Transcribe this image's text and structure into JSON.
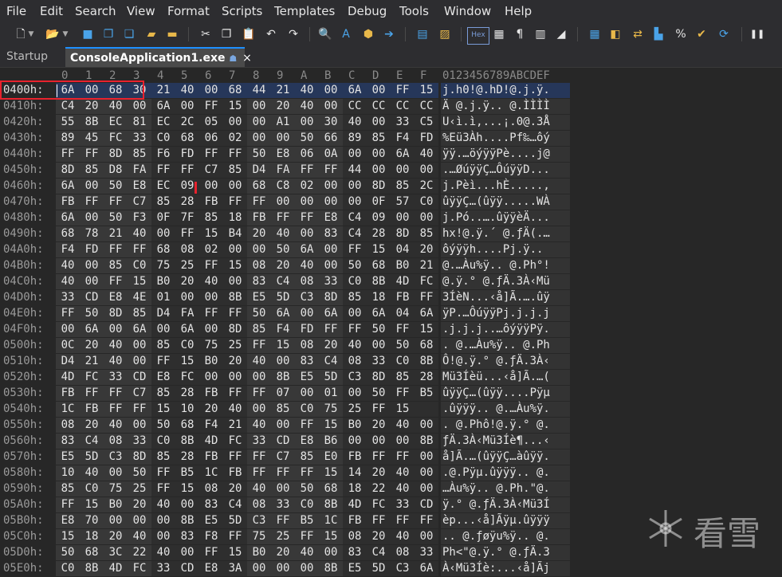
{
  "menu": [
    "File",
    "Edit",
    "Search",
    "View",
    "Format",
    "Scripts",
    "Templates",
    "Debug",
    "Tools",
    "Window",
    "Help"
  ],
  "toolbar": {
    "icons": [
      "new-file-icon",
      "open-icon",
      "save-icon",
      "save-as-icon",
      "save-all-icon",
      "open-folder-icon",
      "cut-icon",
      "copy-icon",
      "paste-icon",
      "undo-icon",
      "redo-icon",
      "find-icon",
      "replace-icon",
      "find-in-files-icon",
      "goto-icon",
      "compare-icon",
      "highlight-icon",
      "hex-mode-icon",
      "text-mode-icon",
      "paragraph-icon",
      "columns-icon",
      "bookmark-icon",
      "calculator-icon",
      "inspector-icon",
      "convert-icon",
      "histogram-icon",
      "checksum-icon",
      "checksum-ok-icon",
      "hash-icon",
      "pause-icon"
    ],
    "hex_label": "Hex"
  },
  "tabs": [
    {
      "label": "Startup",
      "active": false
    },
    {
      "label": "ConsoleApplication1.exe",
      "active": true,
      "close": "×"
    }
  ],
  "hex": {
    "column_headers": [
      "0",
      "1",
      "2",
      "3",
      "4",
      "5",
      "6",
      "7",
      "8",
      "9",
      "A",
      "B",
      "C",
      "D",
      "E",
      "F"
    ],
    "ascii_header": "0123456789ABCDEF",
    "selected_address": "0400h:",
    "rows": [
      {
        "addr": "0400h:",
        "bytes": [
          "6A",
          "00",
          "68",
          "30",
          "21",
          "40",
          "00",
          "68",
          "44",
          "21",
          "40",
          "00",
          "6A",
          "00",
          "FF",
          "15"
        ],
        "ascii": "j.h0!@.hD!@.j.ÿ."
      },
      {
        "addr": "0410h:",
        "bytes": [
          "C4",
          "20",
          "40",
          "00",
          "6A",
          "00",
          "FF",
          "15",
          "00",
          "20",
          "40",
          "00",
          "CC",
          "CC",
          "CC",
          "CC"
        ],
        "ascii": "Ä @.j.ÿ.. @.ÌÌÌÌ"
      },
      {
        "addr": "0420h:",
        "bytes": [
          "55",
          "8B",
          "EC",
          "81",
          "EC",
          "2C",
          "05",
          "00",
          "00",
          "A1",
          "00",
          "30",
          "40",
          "00",
          "33",
          "C5"
        ],
        "ascii": "U‹ì.ì,...¡.0@.3Å"
      },
      {
        "addr": "0430h:",
        "bytes": [
          "89",
          "45",
          "FC",
          "33",
          "C0",
          "68",
          "06",
          "02",
          "00",
          "00",
          "50",
          "66",
          "89",
          "85",
          "F4",
          "FD"
        ],
        "ascii": "%Eü3Àh....Pf‰…ôý"
      },
      {
        "addr": "0440h:",
        "bytes": [
          "FF",
          "FF",
          "8D",
          "85",
          "F6",
          "FD",
          "FF",
          "FF",
          "50",
          "E8",
          "06",
          "0A",
          "00",
          "00",
          "6A",
          "40"
        ],
        "ascii": "ÿÿ.…öýÿÿPè....j@"
      },
      {
        "addr": "0450h:",
        "bytes": [
          "8D",
          "85",
          "D8",
          "FA",
          "FF",
          "FF",
          "C7",
          "85",
          "D4",
          "FA",
          "FF",
          "FF",
          "44",
          "00",
          "00",
          "00"
        ],
        "ascii": ".…ØúÿÿÇ…ÔúÿÿD..."
      },
      {
        "addr": "0460h:",
        "bytes": [
          "6A",
          "00",
          "50",
          "E8",
          "EC",
          "09",
          "00",
          "00",
          "68",
          "C8",
          "02",
          "00",
          "00",
          "8D",
          "85",
          "2C"
        ],
        "ascii": "j.Pèì...hÈ.....,"
      },
      {
        "addr": "0470h:",
        "bytes": [
          "FB",
          "FF",
          "FF",
          "C7",
          "85",
          "28",
          "FB",
          "FF",
          "FF",
          "00",
          "00",
          "00",
          "00",
          "0F",
          "57",
          "C0"
        ],
        "ascii": "ûÿÿÇ…(ûÿÿ.....WÀ"
      },
      {
        "addr": "0480h:",
        "bytes": [
          "6A",
          "00",
          "50",
          "F3",
          "0F",
          "7F",
          "85",
          "18",
          "FB",
          "FF",
          "FF",
          "E8",
          "C4",
          "09",
          "00",
          "00"
        ],
        "ascii": "j.Pó..….ûÿÿèÄ..."
      },
      {
        "addr": "0490h:",
        "bytes": [
          "68",
          "78",
          "21",
          "40",
          "00",
          "FF",
          "15",
          "B4",
          "20",
          "40",
          "00",
          "83",
          "C4",
          "28",
          "8D",
          "85"
        ],
        "ascii": "hx!@.ÿ.´ @.ƒÄ(.…"
      },
      {
        "addr": "04A0h:",
        "bytes": [
          "F4",
          "FD",
          "FF",
          "FF",
          "68",
          "08",
          "02",
          "00",
          "00",
          "50",
          "6A",
          "00",
          "FF",
          "15",
          "04",
          "20"
        ],
        "ascii": "ôýÿÿh....Pj.ÿ.. "
      },
      {
        "addr": "04B0h:",
        "bytes": [
          "40",
          "00",
          "85",
          "C0",
          "75",
          "25",
          "FF",
          "15",
          "08",
          "20",
          "40",
          "00",
          "50",
          "68",
          "B0",
          "21"
        ],
        "ascii": "@.…Àu%ÿ.. @.Ph°!"
      },
      {
        "addr": "04C0h:",
        "bytes": [
          "40",
          "00",
          "FF",
          "15",
          "B0",
          "20",
          "40",
          "00",
          "83",
          "C4",
          "08",
          "33",
          "C0",
          "8B",
          "4D",
          "FC"
        ],
        "ascii": "@.ÿ.° @.ƒÄ.3À‹Mü"
      },
      {
        "addr": "04D0h:",
        "bytes": [
          "33",
          "CD",
          "E8",
          "4E",
          "01",
          "00",
          "00",
          "8B",
          "E5",
          "5D",
          "C3",
          "8D",
          "85",
          "18",
          "FB",
          "FF"
        ],
        "ascii": "3ÍèN...‹å]Ã.….ûÿ"
      },
      {
        "addr": "04E0h:",
        "bytes": [
          "FF",
          "50",
          "8D",
          "85",
          "D4",
          "FA",
          "FF",
          "FF",
          "50",
          "6A",
          "00",
          "6A",
          "00",
          "6A",
          "04",
          "6A"
        ],
        "ascii": "ÿP.…ÔúÿÿPj.j.j.j"
      },
      {
        "addr": "04F0h:",
        "bytes": [
          "00",
          "6A",
          "00",
          "6A",
          "00",
          "6A",
          "00",
          "8D",
          "85",
          "F4",
          "FD",
          "FF",
          "FF",
          "50",
          "FF",
          "15"
        ],
        "ascii": ".j.j.j..…ôýÿÿPÿ."
      },
      {
        "addr": "0500h:",
        "bytes": [
          "0C",
          "20",
          "40",
          "00",
          "85",
          "C0",
          "75",
          "25",
          "FF",
          "15",
          "08",
          "20",
          "40",
          "00",
          "50",
          "68"
        ],
        "ascii": ". @.…Àu%ÿ.. @.Ph"
      },
      {
        "addr": "0510h:",
        "bytes": [
          "D4",
          "21",
          "40",
          "00",
          "FF",
          "15",
          "B0",
          "20",
          "40",
          "00",
          "83",
          "C4",
          "08",
          "33",
          "C0",
          "8B"
        ],
        "ascii": "Ô!@.ÿ.° @.ƒÄ.3À‹"
      },
      {
        "addr": "0520h:",
        "bytes": [
          "4D",
          "FC",
          "33",
          "CD",
          "E8",
          "FC",
          "00",
          "00",
          "00",
          "8B",
          "E5",
          "5D",
          "C3",
          "8D",
          "85",
          "28"
        ],
        "ascii": "Mü3Íèü...‹å]Ã.…("
      },
      {
        "addr": "0530h:",
        "bytes": [
          "FB",
          "FF",
          "FF",
          "C7",
          "85",
          "28",
          "FB",
          "FF",
          "FF",
          "07",
          "00",
          "01",
          "00",
          "50",
          "FF",
          "B5"
        ],
        "ascii": "ûÿÿÇ…(ûÿÿ....Pÿµ"
      },
      {
        "addr": "0540h:",
        "bytes": [
          "1C",
          "FB",
          "FF",
          "FF",
          "15",
          "10",
          "20",
          "40",
          "00",
          "85",
          "C0",
          "75",
          "25",
          "FF",
          "15"
        ],
        "ascii": ".ûÿÿÿ.. @.…Àu%ÿ."
      },
      {
        "addr": "0550h:",
        "bytes": [
          "08",
          "20",
          "40",
          "00",
          "50",
          "68",
          "F4",
          "21",
          "40",
          "00",
          "FF",
          "15",
          "B0",
          "20",
          "40",
          "00"
        ],
        "ascii": ". @.Phô!@.ÿ.° @."
      },
      {
        "addr": "0560h:",
        "bytes": [
          "83",
          "C4",
          "08",
          "33",
          "C0",
          "8B",
          "4D",
          "FC",
          "33",
          "CD",
          "E8",
          "B6",
          "00",
          "00",
          "00",
          "8B"
        ],
        "ascii": "ƒÄ.3À‹Mü3Íè¶...‹"
      },
      {
        "addr": "0570h:",
        "bytes": [
          "E5",
          "5D",
          "C3",
          "8D",
          "85",
          "28",
          "FB",
          "FF",
          "FF",
          "C7",
          "85",
          "E0",
          "FB",
          "FF",
          "FF",
          "00"
        ],
        "ascii": "å]Ã.…(ûÿÿÇ…àûÿÿ."
      },
      {
        "addr": "0580h:",
        "bytes": [
          "10",
          "40",
          "00",
          "50",
          "FF",
          "B5",
          "1C",
          "FB",
          "FF",
          "FF",
          "FF",
          "15",
          "14",
          "20",
          "40",
          "00"
        ],
        "ascii": ".@.Pÿµ.ûÿÿÿ.. @."
      },
      {
        "addr": "0590h:",
        "bytes": [
          "85",
          "C0",
          "75",
          "25",
          "FF",
          "15",
          "08",
          "20",
          "40",
          "00",
          "50",
          "68",
          "18",
          "22",
          "40",
          "00"
        ],
        "ascii": "…Àu%ÿ.. @.Ph.\"@."
      },
      {
        "addr": "05A0h:",
        "bytes": [
          "FF",
          "15",
          "B0",
          "20",
          "40",
          "00",
          "83",
          "C4",
          "08",
          "33",
          "C0",
          "8B",
          "4D",
          "FC",
          "33",
          "CD"
        ],
        "ascii": "ÿ.° @.ƒÄ.3À‹Mü3Í"
      },
      {
        "addr": "05B0h:",
        "bytes": [
          "E8",
          "70",
          "00",
          "00",
          "00",
          "8B",
          "E5",
          "5D",
          "C3",
          "FF",
          "B5",
          "1C",
          "FB",
          "FF",
          "FF",
          "FF"
        ],
        "ascii": "èp...‹å]Ãÿµ.ûÿÿÿ"
      },
      {
        "addr": "05C0h:",
        "bytes": [
          "15",
          "18",
          "20",
          "40",
          "00",
          "83",
          "F8",
          "FF",
          "75",
          "25",
          "FF",
          "15",
          "08",
          "20",
          "40",
          "00"
        ],
        "ascii": ".. @.ƒøÿu%ÿ.. @."
      },
      {
        "addr": "05D0h:",
        "bytes": [
          "50",
          "68",
          "3C",
          "22",
          "40",
          "00",
          "FF",
          "15",
          "B0",
          "20",
          "40",
          "00",
          "83",
          "C4",
          "08",
          "33"
        ],
        "ascii": "Ph<\"@.ÿ.° @.ƒÄ.3"
      },
      {
        "addr": "05E0h:",
        "bytes": [
          "C0",
          "8B",
          "4D",
          "FC",
          "33",
          "CD",
          "E8",
          "3A",
          "00",
          "00",
          "00",
          "8B",
          "E5",
          "5D",
          "C3",
          "6A"
        ],
        "ascii": "À‹Mü3Íè:...‹å]Ãj"
      }
    ]
  },
  "watermark": "看雪"
}
